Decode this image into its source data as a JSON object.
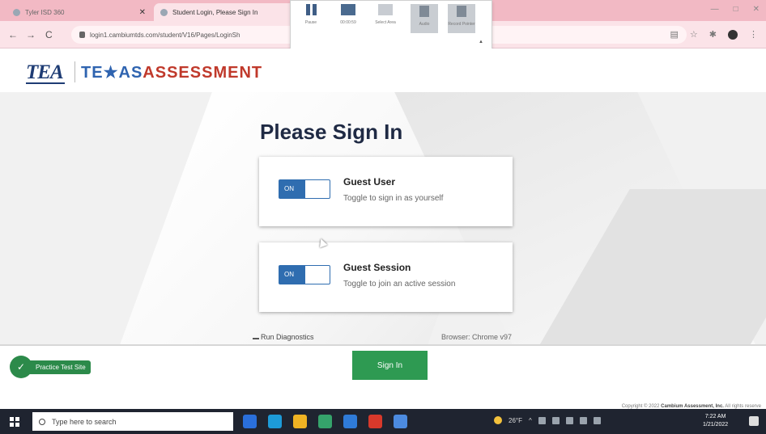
{
  "browser": {
    "tabs": [
      {
        "label": "Tyler ISD 360",
        "active": false
      },
      {
        "label": "Student Login, Please Sign In",
        "active": true
      }
    ],
    "url": "login1.cambiumtds.com/student/V16/Pages/LoginSh",
    "window_controls": [
      "—",
      "□",
      "✕"
    ]
  },
  "recorder_toolbar": {
    "items": [
      "Pause",
      "00:00:59",
      "Select Area",
      "Audio",
      "Record Pointer"
    ]
  },
  "header": {
    "tea_logo": "TEA",
    "brand_te": "TE",
    "brand_star": "★",
    "brand_as": "AS",
    "brand_assessment": "ASSESSMENT"
  },
  "signin": {
    "title": "Please Sign In",
    "cards": [
      {
        "toggle": "ON",
        "title": "Guest User",
        "desc": "Toggle to sign in as yourself"
      },
      {
        "toggle": "ON",
        "title": "Guest Session",
        "desc": "Toggle to join an active session"
      }
    ],
    "diagnostics": "Run Diagnostics",
    "browser_info": "Browser: Chrome v97",
    "button": "Sign In"
  },
  "footer": {
    "practice": "Practice Test Site",
    "copyright_prefix": "Copyright © 2022 ",
    "copyright_company": "Cambium Assessment, Inc.",
    "copyright_suffix": " All rights reserve"
  },
  "taskbar": {
    "search_placeholder": "Type here to search",
    "weather": "26°F",
    "time": "7:22 AM",
    "date": "1/21/2022",
    "app_colors": [
      "#2a6fdb",
      "#1d9bd8",
      "#f0b323",
      "#35a36b",
      "#2f7bd8",
      "#d8392b",
      "#4c8be0"
    ]
  }
}
